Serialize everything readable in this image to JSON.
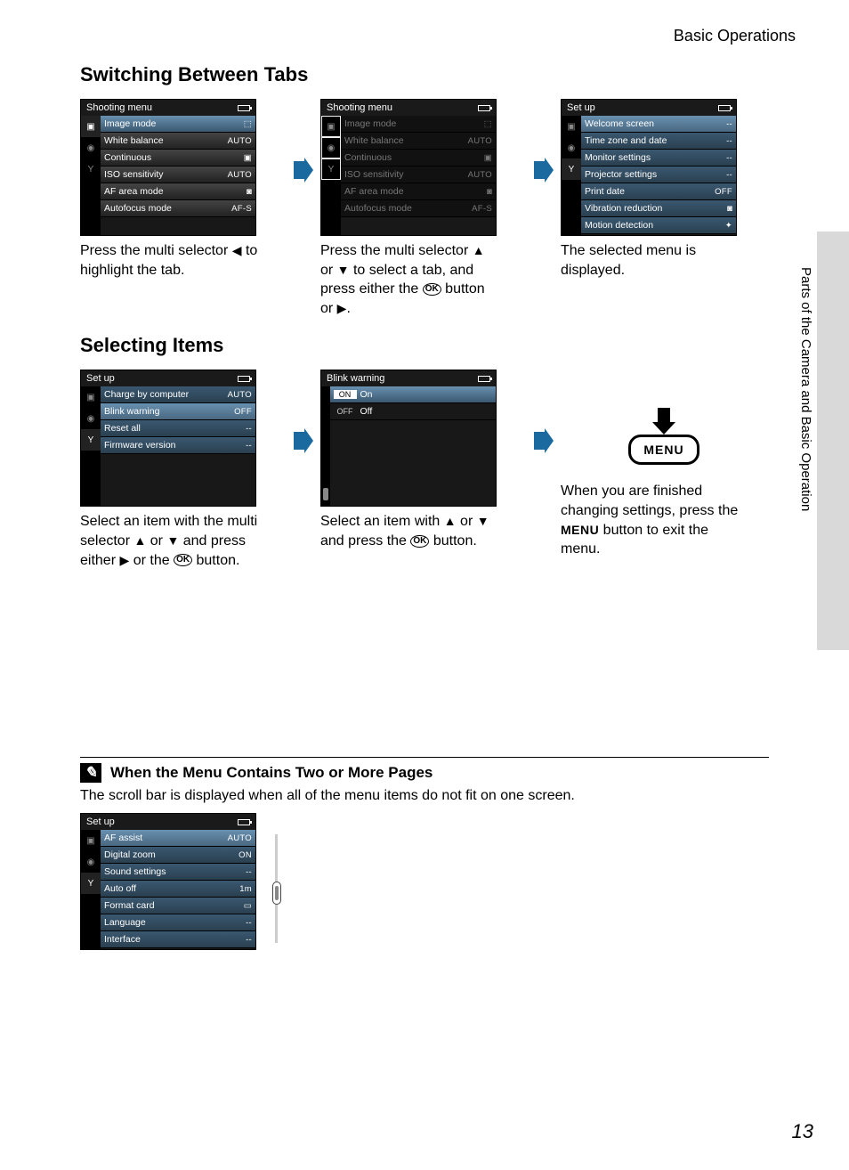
{
  "breadcrumb": "Basic Operations",
  "side_label": "Parts of the Camera and Basic Operation",
  "page_number": "13",
  "section1_title": "Switching Between Tabs",
  "section2_title": "Selecting Items",
  "note": {
    "title": "When the Menu Contains Two or More Pages",
    "body": "The scroll bar is displayed when all of the menu items do not fit on one screen."
  },
  "captions": {
    "s1c1a": "Press the multi selector ",
    "s1c1b": " to highlight the tab.",
    "s1c2a": "Press the multi selector ",
    "s1c2b": " or ",
    "s1c2c": " to select a tab, and press either the ",
    "s1c2d": " button or ",
    "s1c2e": ".",
    "s1c3": "The selected menu is displayed.",
    "s2c1a": "Select an item with the multi selector ",
    "s2c1b": " or ",
    "s2c1c": " and press either ",
    "s2c1d": " or the ",
    "s2c1e": " button.",
    "s2c2a": "Select an item with ",
    "s2c2b": " or ",
    "s2c2c": " and press the ",
    "s2c2d": " button.",
    "s2c3a": "When you are finished changing settings, press the ",
    "s2c3b": " button to exit the menu."
  },
  "glyphs": {
    "left": "◀",
    "right": "▶",
    "up": "▲",
    "down": "▼",
    "ok": "OK",
    "menu": "MENU"
  },
  "menubtn_label": "MENU",
  "lcd_shooting": {
    "title": "Shooting menu",
    "items": [
      {
        "label": "Image mode",
        "val": "⬚"
      },
      {
        "label": "White balance",
        "val": "AUTO"
      },
      {
        "label": "Continuous",
        "val": "▣"
      },
      {
        "label": "ISO sensitivity",
        "val": "AUTO"
      },
      {
        "label": "AF area mode",
        "val": "◙"
      },
      {
        "label": "Autofocus mode",
        "val": "AF-S"
      }
    ]
  },
  "lcd_setup": {
    "title": "Set up",
    "items": [
      {
        "label": "Welcome screen",
        "val": "--"
      },
      {
        "label": "Time zone and date",
        "val": "--"
      },
      {
        "label": "Monitor settings",
        "val": "--"
      },
      {
        "label": "Projector settings",
        "val": "--"
      },
      {
        "label": "Print date",
        "val": "OFF"
      },
      {
        "label": "Vibration reduction",
        "val": "◙"
      },
      {
        "label": "Motion detection",
        "val": "✦"
      }
    ]
  },
  "lcd_setup2": {
    "title": "Set up",
    "items": [
      {
        "label": "Charge by computer",
        "val": "AUTO"
      },
      {
        "label": "Blink warning",
        "val": "OFF"
      },
      {
        "label": "Reset all",
        "val": "--"
      },
      {
        "label": "Firmware version",
        "val": "--"
      }
    ]
  },
  "lcd_blink": {
    "title": "Blink warning",
    "options": [
      {
        "badge": "ON",
        "label": "On"
      },
      {
        "badge": "OFF",
        "label": "Off"
      }
    ]
  },
  "lcd_setup3": {
    "title": "Set up",
    "items": [
      {
        "label": "AF assist",
        "val": "AUTO"
      },
      {
        "label": "Digital zoom",
        "val": "ON"
      },
      {
        "label": "Sound settings",
        "val": "--"
      },
      {
        "label": "Auto off",
        "val": "1m"
      },
      {
        "label": "Format card",
        "val": "▭"
      },
      {
        "label": "Language",
        "val": "--"
      },
      {
        "label": "Interface",
        "val": "--"
      }
    ]
  }
}
